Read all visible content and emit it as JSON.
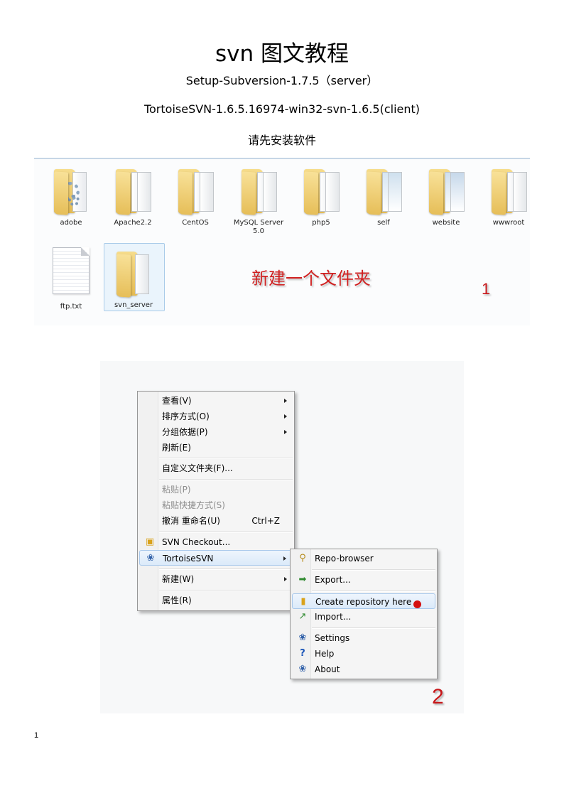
{
  "document": {
    "title": "svn 图文教程",
    "line1": "Setup-Subversion-1.7.5（server）",
    "line2": "TortoiseSVN-1.6.5.16974-win32-svn-1.6.5(client)",
    "line3": "请先安装软件",
    "page_number": "1"
  },
  "explorer": {
    "folders": [
      {
        "label": "adobe",
        "icon": "folder-gear-icon"
      },
      {
        "label": "Apache2.2",
        "icon": "folder-icon"
      },
      {
        "label": "CentOS",
        "icon": "folder-icon"
      },
      {
        "label": "MySQL Server 5.0",
        "icon": "folder-icon"
      },
      {
        "label": "php5",
        "icon": "folder-icon"
      },
      {
        "label": "self",
        "icon": "folder-icon"
      },
      {
        "label": "website",
        "icon": "folder-icon"
      },
      {
        "label": "wwwroot",
        "icon": "folder-icon"
      }
    ],
    "files": [
      {
        "label": "ftp.txt",
        "icon": "text-file-icon"
      },
      {
        "label": "svn_server",
        "icon": "folder-icon",
        "selected": true
      }
    ],
    "annotation": "新建一个文件夹",
    "step": "1"
  },
  "context_menu": {
    "items": [
      {
        "label": "查看(V)",
        "submenu": true
      },
      {
        "label": "排序方式(O)",
        "submenu": true
      },
      {
        "label": "分组依据(P)",
        "submenu": true
      },
      {
        "label": "刷新(E)"
      },
      {
        "label": "自定义文件夹(F)..."
      },
      {
        "label": "粘贴(P)",
        "disabled": true
      },
      {
        "label": "粘贴快捷方式(S)",
        "disabled": true
      },
      {
        "label": "撤消 重命名(U)",
        "shortcut": "Ctrl+Z"
      },
      {
        "label": "SVN Checkout...",
        "icon": "svn-checkout-icon"
      },
      {
        "label": "TortoiseSVN",
        "icon": "tortoisesvn-icon",
        "submenu": true,
        "highlighted": true
      },
      {
        "label": "新建(W)",
        "submenu": true
      },
      {
        "label": "属性(R)"
      }
    ],
    "submenu": [
      {
        "label": "Repo-browser",
        "icon": "repo-browser-icon"
      },
      {
        "label": "Export...",
        "icon": "export-icon"
      },
      {
        "label": "Create repository here",
        "icon": "create-repository-icon",
        "highlighted": true
      },
      {
        "label": "Import...",
        "icon": "import-icon"
      },
      {
        "label": "Settings",
        "icon": "settings-icon"
      },
      {
        "label": "Help",
        "icon": "help-icon"
      },
      {
        "label": "About",
        "icon": "about-icon"
      }
    ],
    "step": "2"
  },
  "colors": {
    "annotation_red": "#d01f1f",
    "folder_yellow": "#e6be58",
    "highlight_blue": "#dbeaf9"
  }
}
